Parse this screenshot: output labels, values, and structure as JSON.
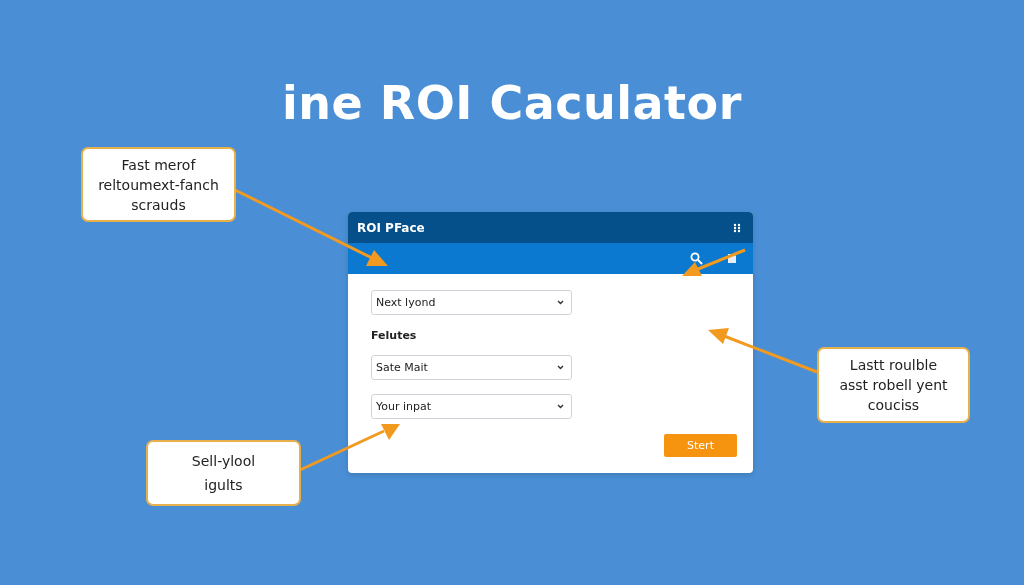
{
  "title": "ine ROI Caculator",
  "panel": {
    "title": "ROI PFace",
    "fields": [
      {
        "kind": "dropdown",
        "value": "Next lyond"
      },
      {
        "kind": "label",
        "text": "Felutes"
      },
      {
        "kind": "dropdown",
        "value": "Sate Mait"
      },
      {
        "kind": "dropdown",
        "value": "Your inpat"
      }
    ],
    "button": "Stert"
  },
  "callouts": [
    {
      "text": "Fast merof\nreltoumext-fanch\nscrauds"
    },
    {
      "text": "Lastt roulble\nasst robell yent\ncouciss"
    },
    {
      "text": "Sell-ylool\nigults"
    }
  ]
}
